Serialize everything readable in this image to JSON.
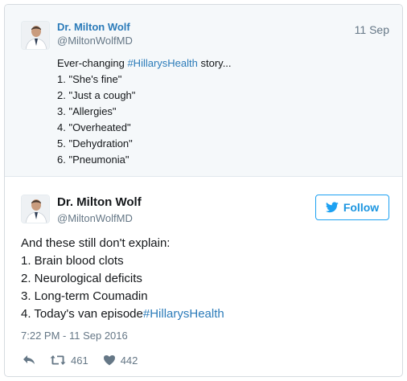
{
  "quoted_tweet": {
    "author_name": "Dr. Milton Wolf",
    "author_handle": "@MiltonWolfMD",
    "date": "11 Sep",
    "intro_prefix": "Ever-changing ",
    "intro_hashtag": "#HillarysHealth",
    "intro_suffix": " story...",
    "lines": [
      "1. \"She's fine\"",
      "2. \"Just a cough\"",
      "3. \"Allergies\"",
      "4. \"Overheated\"",
      "5. \"Dehydration\"",
      "6. \"Pneumonia\""
    ]
  },
  "tweet": {
    "author_name": "Dr. Milton Wolf",
    "author_handle": "@MiltonWolfMD",
    "follow_label": "Follow",
    "lines": [
      "And these still don't explain:",
      "1. Brain blood clots",
      "2. Neurological deficits",
      "3. Long-term Coumadin"
    ],
    "last_line_text": "4. Today's van episode",
    "last_line_hashtag": "#HillarysHealth",
    "timestamp": "7:22 PM - 11 Sep 2016",
    "retweet_count": "461",
    "like_count": "442"
  },
  "icons": {
    "reply": "reply-icon",
    "retweet": "retweet-icon",
    "like": "heart-icon",
    "follow": "twitter-bird-icon"
  },
  "colors": {
    "link": "#2b7bb9",
    "follow": "#1da1f2",
    "muted": "#657786",
    "quoted_background": "#f5f8fa"
  }
}
